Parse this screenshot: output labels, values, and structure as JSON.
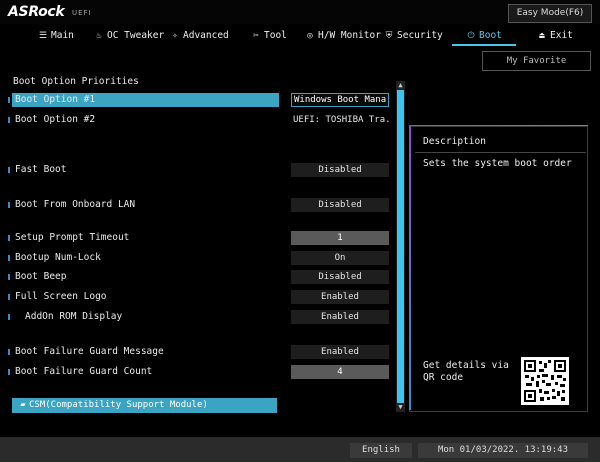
{
  "header": {
    "logo": "ASRock",
    "logo_sub": "UEFI",
    "easy_mode": "Easy Mode(F6)"
  },
  "tabs": [
    {
      "label": "Main",
      "icon": "list-icon",
      "glyph": "☰"
    },
    {
      "label": "OC Tweaker",
      "icon": "flame-icon",
      "glyph": "♨"
    },
    {
      "label": "Advanced",
      "icon": "star-icon",
      "glyph": "✧"
    },
    {
      "label": "Tool",
      "icon": "wrench-icon",
      "glyph": "✂"
    },
    {
      "label": "H/W Monitor",
      "icon": "monitor-icon",
      "glyph": "◎"
    },
    {
      "label": "Security",
      "icon": "shield-icon",
      "glyph": "⛨"
    },
    {
      "label": "Boot",
      "icon": "power-icon",
      "glyph": "⏻"
    },
    {
      "label": "Exit",
      "icon": "exit-door-icon",
      "glyph": "⏏"
    }
  ],
  "favorite": "My Favorite",
  "settings": {
    "section_title": "Boot Option Priorities",
    "boot_option_1": {
      "label": "Boot Option #1",
      "value": "Windows Boot Mana..."
    },
    "boot_option_2": {
      "label": "Boot Option #2",
      "value": "UEFI: TOSHIBA Tra..."
    },
    "fast_boot": {
      "label": "Fast Boot",
      "value": "Disabled"
    },
    "boot_from_lan": {
      "label": "Boot From Onboard LAN",
      "value": "Disabled"
    },
    "setup_prompt_timeout": {
      "label": "Setup Prompt Timeout",
      "value": "1"
    },
    "bootup_numlock": {
      "label": "Bootup Num-Lock",
      "value": "On"
    },
    "boot_beep": {
      "label": "Boot Beep",
      "value": "Disabled"
    },
    "full_screen_logo": {
      "label": "Full Screen Logo",
      "value": "Enabled"
    },
    "addon_rom_display": {
      "label": "AddOn ROM Display",
      "value": "Enabled"
    },
    "boot_failure_guard_msg": {
      "label": "Boot Failure Guard Message",
      "value": "Enabled"
    },
    "boot_failure_guard_count": {
      "label": "Boot Failure Guard Count",
      "value": "4"
    },
    "csm": {
      "label": "CSM(Compatibility Support Module)",
      "glyph": "▰"
    }
  },
  "description": {
    "title": "Description",
    "text": "Sets the system boot order",
    "qr_text": "Get details via QR code"
  },
  "status": {
    "language": "English",
    "datetime": "Mon 01/03/2022. 13:19:43"
  },
  "colors": {
    "accent": "#3ec3ec",
    "highlight": "#3aa4c2",
    "background": "#000000"
  }
}
